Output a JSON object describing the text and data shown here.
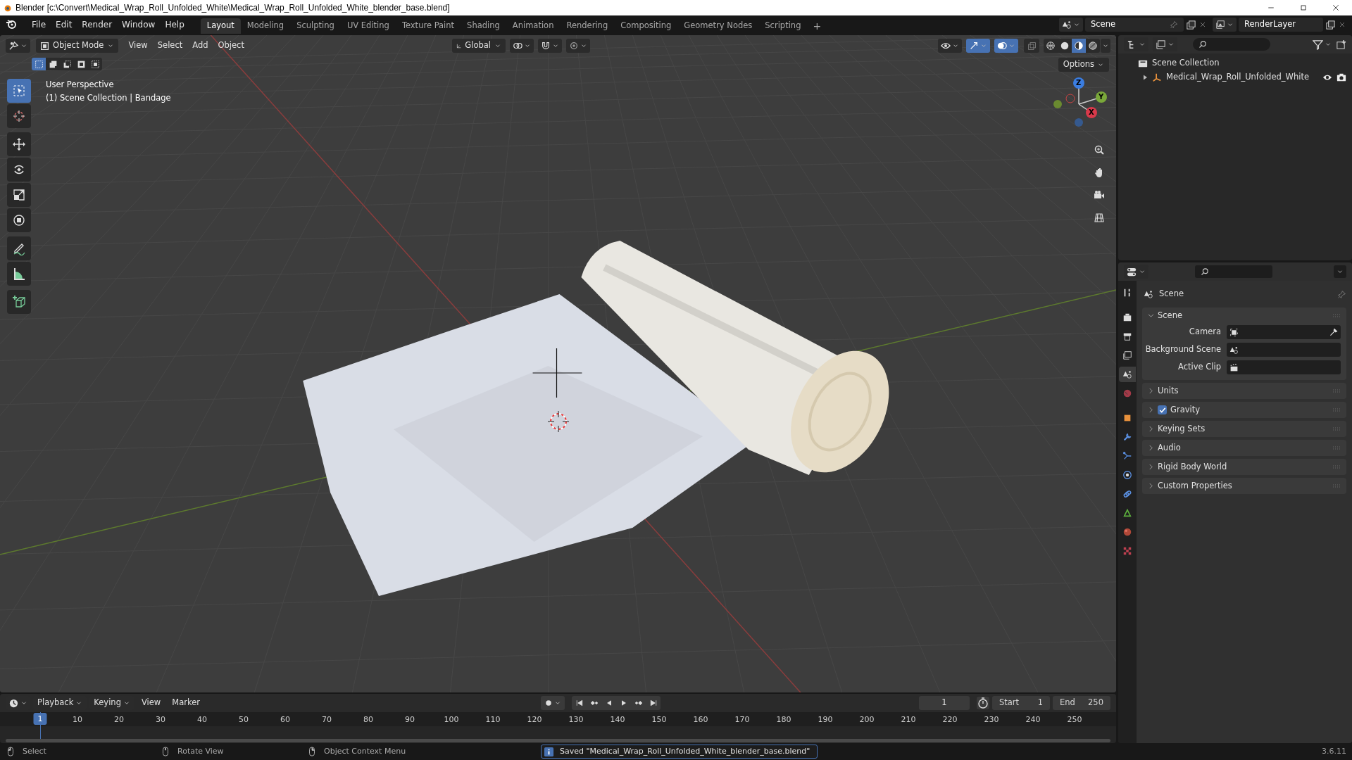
{
  "window": {
    "title": "Blender [c:\\Convert\\Medical_Wrap_Roll_Unfolded_White\\Medical_Wrap_Roll_Unfolded_White_blender_base.blend]"
  },
  "menu": [
    "File",
    "Edit",
    "Render",
    "Window",
    "Help"
  ],
  "workspaces": [
    {
      "label": "Layout",
      "selected": true
    },
    {
      "label": "Modeling",
      "selected": false
    },
    {
      "label": "Sculpting",
      "selected": false
    },
    {
      "label": "UV Editing",
      "selected": false
    },
    {
      "label": "Texture Paint",
      "selected": false
    },
    {
      "label": "Shading",
      "selected": false
    },
    {
      "label": "Animation",
      "selected": false
    },
    {
      "label": "Rendering",
      "selected": false
    },
    {
      "label": "Compositing",
      "selected": false
    },
    {
      "label": "Geometry Nodes",
      "selected": false
    },
    {
      "label": "Scripting",
      "selected": false
    }
  ],
  "add_workspace": "+",
  "scene_selector": {
    "value": "Scene"
  },
  "view_layer": {
    "value": "RenderLayer"
  },
  "viewport_header": {
    "mode": "Object Mode",
    "menus": [
      "View",
      "Select",
      "Add",
      "Object"
    ],
    "orientation": "Global",
    "options": "Options",
    "select_modes": [
      {
        "kind": "set",
        "selected": true
      },
      {
        "kind": "extend",
        "selected": false
      },
      {
        "kind": "subtract",
        "selected": false
      },
      {
        "kind": "invert",
        "selected": false
      },
      {
        "kind": "intersect",
        "selected": false
      }
    ],
    "gizmos_on": true,
    "overlays_on": true,
    "shading": [
      {
        "kind": "wireframe",
        "selected": false
      },
      {
        "kind": "solid",
        "selected": false
      },
      {
        "kind": "material",
        "selected": true
      },
      {
        "kind": "rendered",
        "selected": false
      }
    ]
  },
  "viewport_info": [
    "User Perspective",
    "(1) Scene Collection | Bandage"
  ],
  "gizmo_axes": [
    "Z",
    "Y",
    "X"
  ],
  "tools": [
    [
      {
        "kind": "select",
        "selected": true
      },
      {
        "kind": "cursor",
        "selected": false
      }
    ],
    [
      {
        "kind": "move",
        "selected": false
      },
      {
        "kind": "rotate",
        "selected": false
      },
      {
        "kind": "scale",
        "selected": false
      },
      {
        "kind": "transform",
        "selected": false
      }
    ],
    [
      {
        "kind": "annotate",
        "selected": false
      },
      {
        "kind": "measure",
        "selected": false
      }
    ],
    [
      {
        "kind": "add_cube",
        "selected": false
      }
    ]
  ],
  "outliner": {
    "label": "Scene Collection",
    "children": [
      {
        "label": "Medical_Wrap_Roll_Unfolded_White",
        "expanded": false
      }
    ]
  },
  "properties": {
    "title": "Scene",
    "tabs": [
      {
        "kind": "tool",
        "selected": false
      },
      {
        "kind": "render",
        "selected": false
      },
      {
        "kind": "output",
        "selected": false
      },
      {
        "kind": "view_layer",
        "selected": false
      },
      {
        "kind": "scene",
        "selected": true
      },
      {
        "kind": "world",
        "selected": false
      },
      {
        "kind": "object",
        "selected": false
      },
      {
        "kind": "modifiers",
        "selected": false
      },
      {
        "kind": "particles",
        "selected": false
      },
      {
        "kind": "physics",
        "selected": false
      },
      {
        "kind": "constraints",
        "selected": false
      },
      {
        "kind": "data",
        "selected": false
      },
      {
        "kind": "material",
        "selected": false
      },
      {
        "kind": "texture",
        "selected": false
      }
    ],
    "panels": [
      {
        "label": "Scene",
        "expanded": true,
        "fields": [
          {
            "label": "Camera",
            "kind": "camera"
          },
          {
            "label": "Background Scene",
            "kind": "scene"
          },
          {
            "label": "Active Clip",
            "kind": "clip"
          }
        ]
      },
      {
        "label": "Units",
        "expanded": false
      },
      {
        "label": "Gravity",
        "expanded": false,
        "checked": true
      },
      {
        "label": "Keying Sets",
        "expanded": false
      },
      {
        "label": "Audio",
        "expanded": false
      },
      {
        "label": "Rigid Body World",
        "expanded": false
      },
      {
        "label": "Custom Properties",
        "expanded": false
      }
    ]
  },
  "timeline": {
    "menus": [
      "Playback",
      "Keying",
      "View",
      "Marker"
    ],
    "current_frame": "1",
    "frame_field": "1",
    "start_label": "Start",
    "start": "1",
    "end_label": "End",
    "end": "250",
    "frame_labels": [
      "10",
      "20",
      "30",
      "40",
      "50",
      "60",
      "70",
      "80",
      "90",
      "100",
      "110",
      "120",
      "130",
      "140",
      "150",
      "160",
      "170",
      "180",
      "190",
      "200",
      "210",
      "220",
      "230",
      "240",
      "250"
    ]
  },
  "status_bar": {
    "hints": [
      "Select",
      "Rotate View",
      "Object Context Menu"
    ],
    "message": "Saved \"Medical_Wrap_Roll_Unfolded_White_blender_base.blend\"",
    "version": "3.6.11"
  }
}
